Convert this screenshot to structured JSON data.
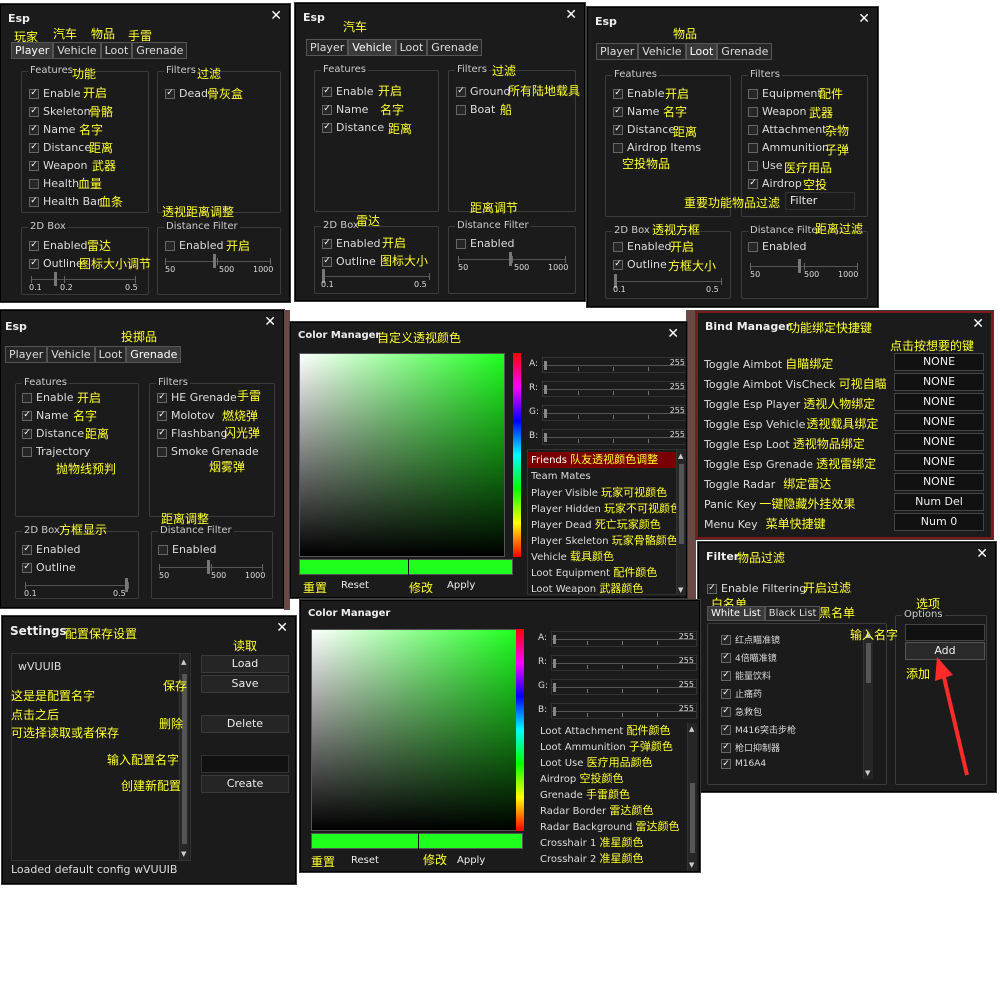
{
  "esp_windows": [
    {
      "title": "Esp",
      "tabs": [
        "Player",
        "Vehicle",
        "Loot",
        "Grenade"
      ],
      "active_tab": 0,
      "tab_annotations": [
        "玩家",
        "汽车",
        "物品",
        "手雷"
      ],
      "features_label": "Features",
      "features_annotation": "功能",
      "features": [
        {
          "label": "Enable",
          "checked": true,
          "annotation": "开启"
        },
        {
          "label": "Skeleton",
          "checked": true,
          "annotation": "骨骼"
        },
        {
          "label": "Name",
          "checked": true,
          "annotation": "名字"
        },
        {
          "label": "Distance",
          "checked": true,
          "annotation": "距离"
        },
        {
          "label": "Weapon",
          "checked": true,
          "annotation": "武器"
        },
        {
          "label": "Health",
          "checked": false,
          "annotation": "血量"
        },
        {
          "label": "Health Bar",
          "checked": true,
          "annotation": "血条"
        }
      ],
      "filters_label": "Filters",
      "filters_annotation": "过滤",
      "filters": [
        {
          "label": "Dead",
          "checked": true,
          "annotation": "骨灰盒"
        }
      ],
      "filters_note": "透视距离调整",
      "box_label": "2D Box",
      "box_items": [
        {
          "label": "Enabled",
          "checked": true,
          "annotation": "雷达"
        },
        {
          "label": "Outline",
          "checked": true,
          "annotation": "图标大小调节"
        }
      ],
      "box_slider": {
        "ticks": [
          "0.1",
          "0.2",
          "0.5"
        ],
        "value": 0.1
      },
      "dist_label": "Distance Filter",
      "dist_enabled": {
        "label": "Enabled",
        "checked": false,
        "annotation": "开启"
      },
      "dist_slider": {
        "ticks": [
          "50",
          "500",
          "1000"
        ],
        "value": 500
      }
    },
    {
      "title": "Esp",
      "tabs": [
        "Player",
        "Vehicle",
        "Loot",
        "Grenade"
      ],
      "active_tab": 1,
      "title_annotation": "汽车",
      "features_label": "Features",
      "features": [
        {
          "label": "Enable",
          "checked": true,
          "annotation": "开启"
        },
        {
          "label": "Name",
          "checked": true,
          "annotation": "名字"
        },
        {
          "label": "Distance",
          "checked": true,
          "annotation": "距离"
        }
      ],
      "filters_label": "Filters",
      "filters_annotation": "过滤",
      "filters": [
        {
          "label": "Ground",
          "checked": true,
          "annotation": "所有陆地载具"
        },
        {
          "label": "Boat",
          "checked": false,
          "annotation": "船"
        }
      ],
      "filters_note": "距离调节",
      "box_label": "2D Box",
      "box_annotation": "雷达",
      "box_items": [
        {
          "label": "Enabled",
          "checked": true,
          "annotation": "开启"
        },
        {
          "label": "Outline",
          "checked": true,
          "annotation": "图标大小"
        }
      ],
      "box_slider": {
        "ticks": [
          "0.1",
          "0.5"
        ],
        "value": 0.1
      },
      "dist_label": "Distance Filter",
      "dist_enabled": {
        "label": "Enabled",
        "checked": false
      },
      "dist_slider": {
        "ticks": [
          "50",
          "500",
          "1000"
        ],
        "value": 500
      }
    },
    {
      "title": "Esp",
      "tabs": [
        "Player",
        "Vehicle",
        "Loot",
        "Grenade"
      ],
      "active_tab": 2,
      "title_annotation": "物品",
      "features_label": "Features",
      "features": [
        {
          "label": "Enable",
          "checked": true,
          "annotation": "开启"
        },
        {
          "label": "Name",
          "checked": true,
          "annotation": "名字"
        },
        {
          "label": "Distance",
          "checked": true,
          "annotation": "距离"
        },
        {
          "label": "Airdrop Items",
          "checked": false,
          "annotation": "空投物品"
        }
      ],
      "filters_label": "Filters",
      "filters": [
        {
          "label": "Equipment",
          "checked": false,
          "annotation": "配件"
        },
        {
          "label": "Weapon",
          "checked": false,
          "annotation": "武器"
        },
        {
          "label": "Attachment",
          "checked": false,
          "annotation": "杂物"
        },
        {
          "label": "Ammunition",
          "checked": false,
          "annotation": "子弹"
        },
        {
          "label": "Use",
          "checked": false,
          "annotation": "医疗用品"
        },
        {
          "label": "Airdrop",
          "checked": true,
          "annotation": "空投"
        }
      ],
      "filter_button": "Filter",
      "filters_note": "重要功能物品过滤",
      "box_label": "2D Box",
      "box_annotation": "透视方框",
      "box_items": [
        {
          "label": "Enabled",
          "checked": false,
          "annotation": "开启"
        },
        {
          "label": "Outline",
          "checked": true,
          "annotation": "方框大小"
        }
      ],
      "box_slider": {
        "ticks": [
          "0.1",
          "0.5"
        ],
        "value": 0.1
      },
      "dist_label": "Distance Filter",
      "dist_annotation": "距离过滤",
      "dist_enabled": {
        "label": "Enabled",
        "checked": false
      },
      "dist_slider": {
        "ticks": [
          "50",
          "500",
          "1000"
        ],
        "value": 500
      }
    },
    {
      "title": "Esp",
      "tabs": [
        "Player",
        "Vehicle",
        "Loot",
        "Grenade"
      ],
      "active_tab": 3,
      "title_annotation": "投掷品",
      "features_label": "Features",
      "features": [
        {
          "label": "Enable",
          "checked": false,
          "annotation": "开启"
        },
        {
          "label": "Name",
          "checked": true,
          "annotation": "名字"
        },
        {
          "label": "Distance",
          "checked": true,
          "annotation": "距离"
        },
        {
          "label": "Trajectory",
          "checked": false,
          "annotation": "抛物线预判"
        }
      ],
      "filters_label": "Filters",
      "filters": [
        {
          "label": "HE Grenade",
          "checked": true,
          "annotation": "手雷"
        },
        {
          "label": "Molotov",
          "checked": true,
          "annotation": "燃烧弹"
        },
        {
          "label": "Flashbang",
          "checked": true,
          "annotation": "闪光弹"
        },
        {
          "label": "Smoke Grenade",
          "checked": false,
          "annotation": "烟雾弹"
        }
      ],
      "filters_note": "距离调整",
      "box_label": "2D Box",
      "box_annotation": "方框显示",
      "box_items": [
        {
          "label": "Enabled",
          "checked": true
        },
        {
          "label": "Outline",
          "checked": true
        }
      ],
      "box_slider": {
        "ticks": [
          "0.1",
          "0.5"
        ],
        "value": 0.5
      },
      "dist_label": "Distance Filter",
      "dist_enabled": {
        "label": "Enabled",
        "checked": false
      },
      "dist_slider": {
        "ticks": [
          "50",
          "500",
          "1000"
        ],
        "value": 500
      }
    }
  ],
  "color_manager_top": {
    "title": "Color Manager",
    "title_annotation": "自定义透视颜色",
    "channels": [
      {
        "label": "A:",
        "value": "255"
      },
      {
        "label": "R:",
        "value": "255"
      },
      {
        "label": "G:",
        "value": "255"
      },
      {
        "label": "B:",
        "value": "255"
      }
    ],
    "items": [
      {
        "label": "Friends",
        "annotation": "队友透视颜色调整",
        "selected": true
      },
      {
        "label": "Team Mates"
      },
      {
        "label": "Player Visible",
        "annotation": "玩家可视颜色"
      },
      {
        "label": "Player Hidden",
        "annotation": "玩家不可视颜色"
      },
      {
        "label": "Player Dead",
        "annotation": "死亡玩家颜色"
      },
      {
        "label": "Player Skeleton",
        "annotation": "玩家骨骼颜色"
      },
      {
        "label": "Vehicle",
        "annotation": "载具颜色"
      },
      {
        "label": "Loot Equipment",
        "annotation": "配件颜色"
      },
      {
        "label": "Loot Weapon",
        "annotation": "武器颜色"
      }
    ],
    "reset": "Reset",
    "reset_annotation": "重置",
    "apply": "Apply",
    "apply_annotation": "修改",
    "color": "#1eff1e"
  },
  "color_manager_bottom": {
    "title": "Color Manager",
    "channels": [
      {
        "label": "A:",
        "value": "255"
      },
      {
        "label": "R:",
        "value": "255"
      },
      {
        "label": "G:",
        "value": "255"
      },
      {
        "label": "B:",
        "value": "255"
      }
    ],
    "items": [
      {
        "label": "Loot Attachment",
        "annotation": "配件颜色"
      },
      {
        "label": "Loot Ammunition",
        "annotation": "子弹颜色"
      },
      {
        "label": "Loot Use",
        "annotation": "医疗用品颜色"
      },
      {
        "label": "Airdrop",
        "annotation": "空投颜色"
      },
      {
        "label": "Grenade",
        "annotation": "手雷颜色"
      },
      {
        "label": "Radar Border",
        "annotation": "雷达颜色"
      },
      {
        "label": "Radar Background",
        "annotation": "雷达颜色"
      },
      {
        "label": "Crosshair 1",
        "annotation": "准星颜色"
      },
      {
        "label": "Crosshair 2",
        "annotation": "准星颜色"
      }
    ],
    "reset": "Reset",
    "reset_annotation": "重置",
    "apply": "Apply",
    "apply_annotation": "修改",
    "color": "#1eff1e"
  },
  "bind_manager": {
    "title": "Bind Manager",
    "title_annotation": "功能绑定快捷键",
    "hint": "点击按想要的键",
    "rows": [
      {
        "label": "Toggle Aimbot",
        "annotation": "自瞄绑定",
        "key": "NONE"
      },
      {
        "label": "Toggle Aimbot VisCheck",
        "annotation": "可视自瞄",
        "key": "NONE"
      },
      {
        "label": "Toggle Esp Player",
        "annotation": "透视人物绑定",
        "key": "NONE"
      },
      {
        "label": "Toggle Esp Vehicle",
        "annotation": "透视载具绑定",
        "key": "NONE"
      },
      {
        "label": "Toggle Esp Loot",
        "annotation": "透视物品绑定",
        "key": "NONE"
      },
      {
        "label": "Toggle Esp Grenade",
        "annotation": "透视雷绑定",
        "key": "NONE"
      },
      {
        "label": "Toggle Radar",
        "annotation": "绑定雷达",
        "key": "NONE"
      },
      {
        "label": "Panic Key",
        "annotation": "一键隐藏外挂效果",
        "key": "Num Del"
      },
      {
        "label": "Menu Key",
        "annotation": "菜单快捷键",
        "key": "Num 0"
      }
    ]
  },
  "filter_window": {
    "title": "Filter",
    "title_annotation": "物品过滤",
    "enable_filtering": {
      "label": "Enable Filtering",
      "checked": true,
      "annotation": "开启过滤"
    },
    "white_list": "White List",
    "white_annotation": "白名单",
    "black_list": "Black List",
    "black_annotation": "黑名单",
    "options_label": "Options",
    "options_annotation": "选项",
    "input_annotation": "输入名字",
    "add": "Add",
    "add_annotation": "添加",
    "items": [
      "红点瞄准镜",
      "4倍瞄准镜",
      "能量饮料",
      "止痛药",
      "急救包",
      "M416突击步枪",
      "枪口抑制器",
      "M16A4"
    ]
  },
  "settings": {
    "title": "Settings",
    "title_annotation": "配置保存设置",
    "config_name": "wVUUIB",
    "load": "Load",
    "load_annotation": "读取",
    "save": "Save",
    "save_annotation": "保存",
    "delete": "Delete",
    "delete_annotation": "删除",
    "create": "Create",
    "create_annotation": "创建新配置",
    "input_annotation": "输入配置名字",
    "note_lines": [
      "这是是配置名字",
      "点击之后",
      "可选择读取或者保存"
    ],
    "status": "Loaded default config wVUUIB"
  }
}
